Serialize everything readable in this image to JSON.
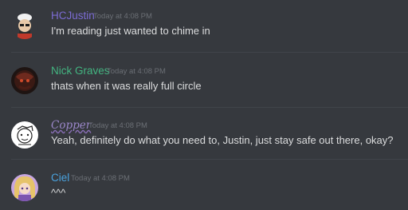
{
  "messages": [
    {
      "author": "HCJustin",
      "author_color": "#7c6cd4",
      "timestamp": "Today at 4:08 PM",
      "text": "I'm reading just wanted to chime in",
      "avatar_icon": "chef-avatar"
    },
    {
      "author": "Nick Graves",
      "author_color": "#43b581",
      "timestamp": "Today at 4:08 PM",
      "text": "thats when it was really full circle",
      "avatar_icon": "dark-creature-avatar"
    },
    {
      "author": "Copper",
      "author_color": "#9b87c9",
      "timestamp": "Today at 4:08 PM",
      "text": "Yeah, definitely do what you need to, Justin, just stay safe out there, okay?",
      "avatar_icon": "sketch-avatar"
    },
    {
      "author": "Ciel",
      "author_color": "#4aa3df",
      "timestamp": "Today at 4:08 PM",
      "text": "^^^",
      "avatar_icon": "anime-girl-avatar"
    }
  ]
}
